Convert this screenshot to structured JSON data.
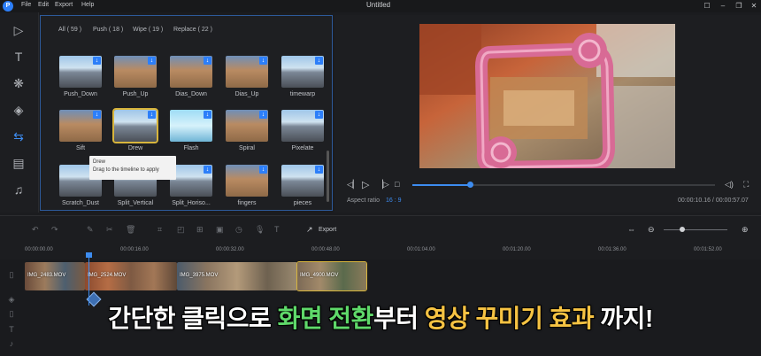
{
  "app": {
    "logo_letter": "P",
    "menu": [
      "File",
      "Edit",
      "Export",
      "Help"
    ],
    "title": "Untitled"
  },
  "library": {
    "tabs": [
      {
        "label": "All ( 59 )",
        "active": true
      },
      {
        "label": "Push ( 18 )",
        "active": false
      },
      {
        "label": "Wipe ( 19 )",
        "active": false
      },
      {
        "label": "Replace ( 22 )",
        "active": false
      }
    ],
    "transitions": [
      {
        "label": "Push_Down",
        "thumb": "road"
      },
      {
        "label": "Push_Up",
        "thumb": "dog"
      },
      {
        "label": "Dias_Down",
        "thumb": "dog"
      },
      {
        "label": "Dias_Up",
        "thumb": "dog"
      },
      {
        "label": "timewarp",
        "thumb": "road"
      },
      {
        "label": "Sift",
        "thumb": "dog"
      },
      {
        "label": "Drew",
        "thumb": "road",
        "selected": true
      },
      {
        "label": "Flash",
        "thumb": "sky"
      },
      {
        "label": "Spiral",
        "thumb": "dog"
      },
      {
        "label": "Pixelate",
        "thumb": "road"
      },
      {
        "label": "Scratch_Dust",
        "thumb": "road"
      },
      {
        "label": "Split_Vertical",
        "thumb": "road"
      },
      {
        "label": "Split_Horiso...",
        "thumb": "road"
      },
      {
        "label": "fingers",
        "thumb": "dog"
      },
      {
        "label": "pieces",
        "thumb": "road"
      }
    ],
    "tooltip": {
      "title": "Drew",
      "text": "Drag to the timeline to apply"
    }
  },
  "preview": {
    "aspect_label": "Aspect ratio",
    "aspect_value": "16 : 9",
    "time_current": "00:00:10.16",
    "time_total": "00:00:57.07",
    "progress": 0.19
  },
  "toolbar": {
    "export_label": "Export"
  },
  "ruler": {
    "ticks": [
      "00:00:00.00",
      "00:00:16.00",
      "00:00:32.00",
      "00:00:48.00",
      "00:01:04.00",
      "00:01:20.00",
      "00:01:36.00",
      "00:01:52.00"
    ]
  },
  "timeline": {
    "clips": [
      "IMG_2483.MOV",
      "IMG_2524.MOV",
      "IMG_3975.MOV",
      "IMG_4900.MOV"
    ]
  },
  "caption": {
    "part1": "간단한 클릭으로 ",
    "part2": "화면 전환",
    "part3": "부터 ",
    "part4": "영상 꾸미기 효과",
    "part5": " 까지!"
  },
  "colors": {
    "accent": "#3d8cf0",
    "selection": "#d8b53c",
    "caption_green": "#5fd96a",
    "caption_yellow": "#f6c343"
  }
}
